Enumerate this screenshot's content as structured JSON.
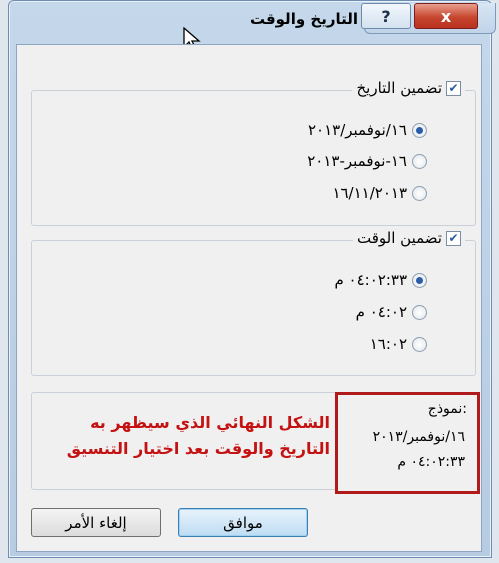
{
  "window": {
    "title": "التاريخ والوقت",
    "help_label": "?",
    "close_label": "x"
  },
  "date_group": {
    "checkbox_label": "تضمين التاريخ",
    "checked": true,
    "options": [
      {
        "label": "١٦/نوفمبر/٢٠١٣",
        "selected": true
      },
      {
        "label": "١٦-نوفمبر-٢٠١٣",
        "selected": false
      },
      {
        "label": "١٦/١١/٢٠١٣",
        "selected": false
      }
    ]
  },
  "time_group": {
    "checkbox_label": "تضمين الوقت",
    "checked": true,
    "options": [
      {
        "label": "٠٤:٠٢:٣٣ م",
        "selected": true
      },
      {
        "label": "٠٤:٠٢ م",
        "selected": false
      },
      {
        "label": "١٦:٠٢",
        "selected": false
      }
    ]
  },
  "preview": {
    "label": "نموذج:",
    "line1": "١٦/نوفمبر/٢٠١٣",
    "line2": "٠٤:٠٢:٣٣ م"
  },
  "annotation": {
    "line1": "الشكل النهائي الذي سيظهر به",
    "line2": "التاريخ والوقت بعد اختيار التنسيق"
  },
  "buttons": {
    "ok_label": "موافق",
    "cancel_label": "إلغاء الأمر"
  }
}
